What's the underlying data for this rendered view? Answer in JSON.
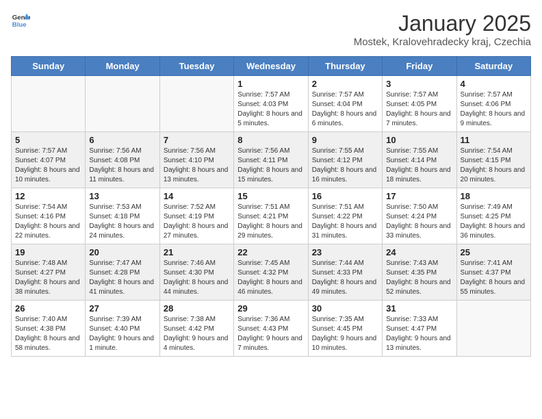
{
  "header": {
    "logo_general": "General",
    "logo_blue": "Blue",
    "title": "January 2025",
    "subtitle": "Mostek, Kralovehradecky kraj, Czechia"
  },
  "days_of_week": [
    "Sunday",
    "Monday",
    "Tuesday",
    "Wednesday",
    "Thursday",
    "Friday",
    "Saturday"
  ],
  "weeks": [
    [
      {
        "day": "",
        "content": ""
      },
      {
        "day": "",
        "content": ""
      },
      {
        "day": "",
        "content": ""
      },
      {
        "day": "1",
        "content": "Sunrise: 7:57 AM\nSunset: 4:03 PM\nDaylight: 8 hours and 5 minutes."
      },
      {
        "day": "2",
        "content": "Sunrise: 7:57 AM\nSunset: 4:04 PM\nDaylight: 8 hours and 6 minutes."
      },
      {
        "day": "3",
        "content": "Sunrise: 7:57 AM\nSunset: 4:05 PM\nDaylight: 8 hours and 7 minutes."
      },
      {
        "day": "4",
        "content": "Sunrise: 7:57 AM\nSunset: 4:06 PM\nDaylight: 8 hours and 9 minutes."
      }
    ],
    [
      {
        "day": "5",
        "content": "Sunrise: 7:57 AM\nSunset: 4:07 PM\nDaylight: 8 hours and 10 minutes."
      },
      {
        "day": "6",
        "content": "Sunrise: 7:56 AM\nSunset: 4:08 PM\nDaylight: 8 hours and 11 minutes."
      },
      {
        "day": "7",
        "content": "Sunrise: 7:56 AM\nSunset: 4:10 PM\nDaylight: 8 hours and 13 minutes."
      },
      {
        "day": "8",
        "content": "Sunrise: 7:56 AM\nSunset: 4:11 PM\nDaylight: 8 hours and 15 minutes."
      },
      {
        "day": "9",
        "content": "Sunrise: 7:55 AM\nSunset: 4:12 PM\nDaylight: 8 hours and 16 minutes."
      },
      {
        "day": "10",
        "content": "Sunrise: 7:55 AM\nSunset: 4:14 PM\nDaylight: 8 hours and 18 minutes."
      },
      {
        "day": "11",
        "content": "Sunrise: 7:54 AM\nSunset: 4:15 PM\nDaylight: 8 hours and 20 minutes."
      }
    ],
    [
      {
        "day": "12",
        "content": "Sunrise: 7:54 AM\nSunset: 4:16 PM\nDaylight: 8 hours and 22 minutes."
      },
      {
        "day": "13",
        "content": "Sunrise: 7:53 AM\nSunset: 4:18 PM\nDaylight: 8 hours and 24 minutes."
      },
      {
        "day": "14",
        "content": "Sunrise: 7:52 AM\nSunset: 4:19 PM\nDaylight: 8 hours and 27 minutes."
      },
      {
        "day": "15",
        "content": "Sunrise: 7:51 AM\nSunset: 4:21 PM\nDaylight: 8 hours and 29 minutes."
      },
      {
        "day": "16",
        "content": "Sunrise: 7:51 AM\nSunset: 4:22 PM\nDaylight: 8 hours and 31 minutes."
      },
      {
        "day": "17",
        "content": "Sunrise: 7:50 AM\nSunset: 4:24 PM\nDaylight: 8 hours and 33 minutes."
      },
      {
        "day": "18",
        "content": "Sunrise: 7:49 AM\nSunset: 4:25 PM\nDaylight: 8 hours and 36 minutes."
      }
    ],
    [
      {
        "day": "19",
        "content": "Sunrise: 7:48 AM\nSunset: 4:27 PM\nDaylight: 8 hours and 38 minutes."
      },
      {
        "day": "20",
        "content": "Sunrise: 7:47 AM\nSunset: 4:28 PM\nDaylight: 8 hours and 41 minutes."
      },
      {
        "day": "21",
        "content": "Sunrise: 7:46 AM\nSunset: 4:30 PM\nDaylight: 8 hours and 44 minutes."
      },
      {
        "day": "22",
        "content": "Sunrise: 7:45 AM\nSunset: 4:32 PM\nDaylight: 8 hours and 46 minutes."
      },
      {
        "day": "23",
        "content": "Sunrise: 7:44 AM\nSunset: 4:33 PM\nDaylight: 8 hours and 49 minutes."
      },
      {
        "day": "24",
        "content": "Sunrise: 7:43 AM\nSunset: 4:35 PM\nDaylight: 8 hours and 52 minutes."
      },
      {
        "day": "25",
        "content": "Sunrise: 7:41 AM\nSunset: 4:37 PM\nDaylight: 8 hours and 55 minutes."
      }
    ],
    [
      {
        "day": "26",
        "content": "Sunrise: 7:40 AM\nSunset: 4:38 PM\nDaylight: 8 hours and 58 minutes."
      },
      {
        "day": "27",
        "content": "Sunrise: 7:39 AM\nSunset: 4:40 PM\nDaylight: 9 hours and 1 minute."
      },
      {
        "day": "28",
        "content": "Sunrise: 7:38 AM\nSunset: 4:42 PM\nDaylight: 9 hours and 4 minutes."
      },
      {
        "day": "29",
        "content": "Sunrise: 7:36 AM\nSunset: 4:43 PM\nDaylight: 9 hours and 7 minutes."
      },
      {
        "day": "30",
        "content": "Sunrise: 7:35 AM\nSunset: 4:45 PM\nDaylight: 9 hours and 10 minutes."
      },
      {
        "day": "31",
        "content": "Sunrise: 7:33 AM\nSunset: 4:47 PM\nDaylight: 9 hours and 13 minutes."
      },
      {
        "day": "",
        "content": ""
      }
    ]
  ]
}
